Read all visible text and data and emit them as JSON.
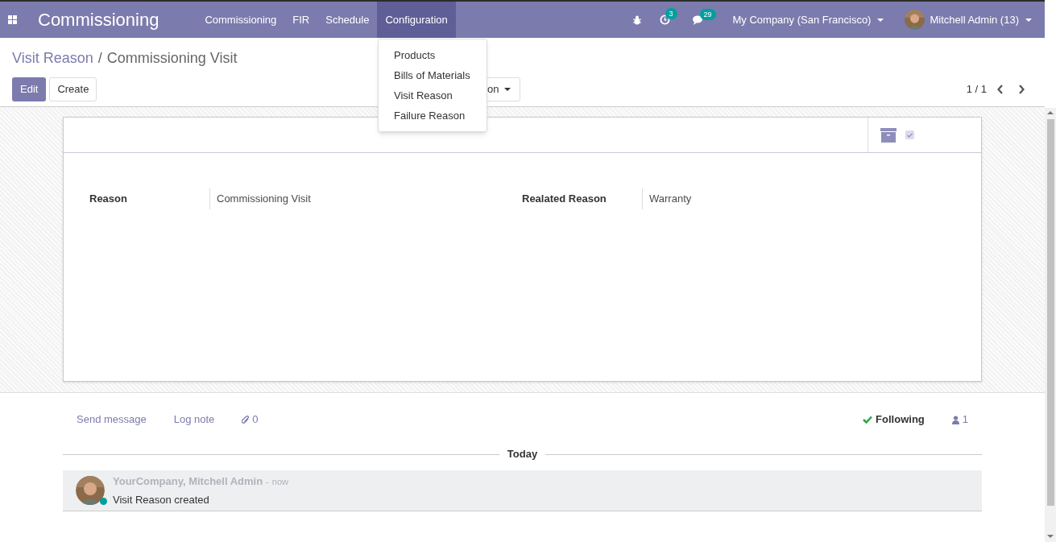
{
  "navbar": {
    "app_title": "Commissioning",
    "menus": [
      {
        "label": "Commissioning",
        "selected": false
      },
      {
        "label": "FIR",
        "selected": false
      },
      {
        "label": "Schedule",
        "selected": false
      },
      {
        "label": "Configuration",
        "selected": true
      }
    ],
    "activity_count": "3",
    "message_count": "29",
    "company": "My Company (San Francisco)",
    "user": "Mitchell Admin (13)"
  },
  "dropdown": {
    "items": [
      "Products",
      "Bills of Materials",
      "Visit Reason",
      "Failure Reason"
    ]
  },
  "breadcrumb": {
    "parent": "Visit Reason",
    "separator": "/",
    "current": "Commissioning Visit"
  },
  "buttons": {
    "edit": "Edit",
    "create": "Create",
    "action": "on"
  },
  "pager": {
    "value": "1 / 1"
  },
  "form": {
    "active": true,
    "fields": [
      {
        "label": "Reason",
        "value": "Commissioning Visit"
      },
      {
        "label": "Realated Reason",
        "value": "Warranty"
      }
    ]
  },
  "chatter": {
    "send_message": "Send message",
    "log_note": "Log note",
    "attachments": "0",
    "following": "Following",
    "followers": "1",
    "date_separator": "Today",
    "messages": [
      {
        "author": "YourCompany, Mitchell Admin",
        "separator": "-",
        "time": "now",
        "body": "Visit Reason created",
        "online": true
      }
    ]
  }
}
